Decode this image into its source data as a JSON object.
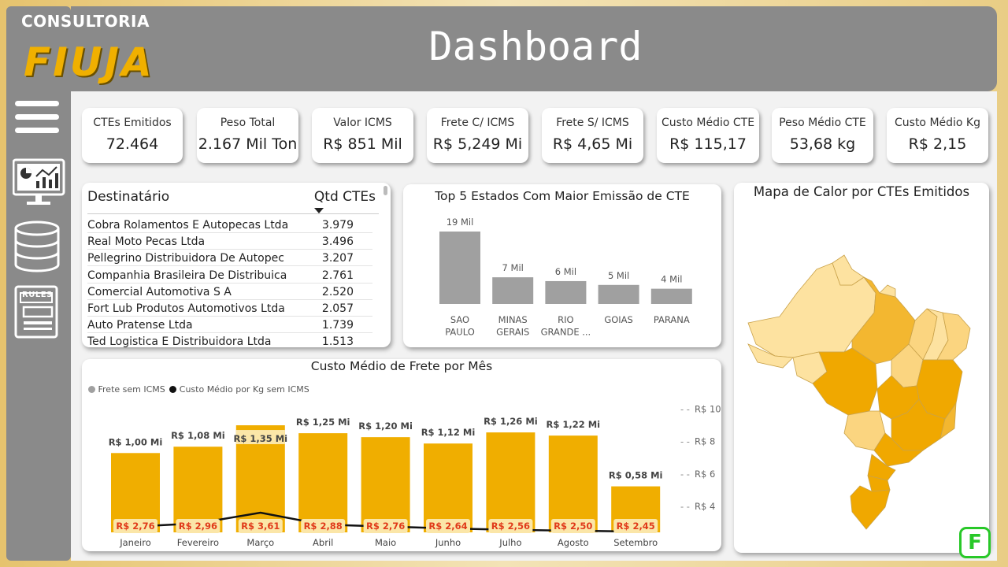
{
  "brand": {
    "line1": "CONSULTORIA",
    "line2": "FIUJA"
  },
  "header": {
    "title": "Dashboard"
  },
  "nav": [
    {
      "name": "menu",
      "icon": "hamburger-menu-icon"
    },
    {
      "name": "dashboard",
      "icon": "monitor-chart-icon"
    },
    {
      "name": "database",
      "icon": "database-icon"
    },
    {
      "name": "rules",
      "icon": "rules-book-icon",
      "label": "RULES"
    }
  ],
  "kpis": [
    {
      "label": "CTEs Emitidos",
      "value": "72.464"
    },
    {
      "label": "Peso Total",
      "value": "2.167 Mil Ton"
    },
    {
      "label": "Valor ICMS",
      "value": "R$ 851 Mil"
    },
    {
      "label": "Frete C/ ICMS",
      "value": "R$ 5,249 Mi"
    },
    {
      "label": "Frete S/ ICMS",
      "value": "R$ 4,65 Mi"
    },
    {
      "label": "Custo Médio CTE",
      "value": "R$ 115,17"
    },
    {
      "label": "Peso Médio CTE",
      "value": "53,68 kg"
    },
    {
      "label": "Custo Médio Kg",
      "value": "R$ 2,15"
    }
  ],
  "table": {
    "col1": "Destinatário",
    "col2": "Qtd CTEs",
    "rows": [
      {
        "name": "Cobra Rolamentos E Autopecas Ltda",
        "qty": "3.979"
      },
      {
        "name": "Real Moto Pecas Ltda",
        "qty": "3.496"
      },
      {
        "name": "Pellegrino Distribuidora De Autopec",
        "qty": "3.207"
      },
      {
        "name": "Companhia Brasileira De Distribuica",
        "qty": "2.761"
      },
      {
        "name": "Comercial Automotiva S A",
        "qty": "2.520"
      },
      {
        "name": "Fort Lub Produtos Automotivos Ltda",
        "qty": "2.057"
      },
      {
        "name": "Auto Pratense Ltda",
        "qty": "1.739"
      },
      {
        "name": "Ted Logistica E Distribuidora Ltda",
        "qty": "1.513"
      }
    ]
  },
  "map": {
    "title": "Mapa de Calor por CTEs Emitidos"
  },
  "badge": {
    "letter": "F"
  },
  "chart_data": [
    {
      "type": "bar",
      "title": "Top 5 Estados Com Maior Emissão de CTE",
      "categories": [
        [
          "SAO",
          "PAULO"
        ],
        [
          "MINAS",
          "GERAIS"
        ],
        [
          "RIO",
          "GRANDE ..."
        ],
        [
          "GOIAS"
        ],
        [
          "PARANA"
        ]
      ],
      "values": [
        19000,
        7000,
        6000,
        5000,
        4000
      ],
      "data_labels": [
        "19 Mil",
        "7 Mil",
        "6 Mil",
        "5 Mil",
        "4 Mil"
      ],
      "ylim": [
        0,
        19000
      ],
      "color": "#a0a0a0"
    },
    {
      "type": "bar",
      "title": "Custo Médio de Frete por Mês",
      "categories": [
        "Janeiro",
        "Fevereiro",
        "Março",
        "Abril",
        "Maio",
        "Junho",
        "Julho",
        "Agosto",
        "Setembro"
      ],
      "series": [
        {
          "name": "Frete sem ICMS",
          "type": "bar",
          "color": "#f0ae00",
          "values": [
            1.0,
            1.08,
            1.35,
            1.25,
            1.2,
            1.12,
            1.26,
            1.22,
            0.58
          ],
          "labels": [
            "R$ 1,00 Mi",
            "R$ 1,08 Mi",
            "R$ 1,35 Mi",
            "R$ 1,25 Mi",
            "R$ 1,20 Mi",
            "R$ 1,12 Mi",
            "R$ 1,26 Mi",
            "R$ 1,22 Mi",
            "R$ 0,58 Mi"
          ]
        },
        {
          "name": "Custo Médio por Kg sem ICMS",
          "type": "line",
          "color": "#111111",
          "values": [
            2.76,
            2.96,
            3.61,
            2.88,
            2.76,
            2.64,
            2.56,
            2.5,
            2.45
          ],
          "labels": [
            "R$ 2,76",
            "R$ 2,96",
            "R$ 3,61",
            "R$ 2,88",
            "R$ 2,76",
            "R$ 2,64",
            "R$ 2,56",
            "R$ 2,50",
            "R$ 2,45"
          ]
        }
      ],
      "ylim": [
        0,
        1.4
      ],
      "y2lim": [
        2.4,
        10.4
      ],
      "y2ticks": [
        4,
        6,
        8,
        10
      ],
      "y2tick_labels": [
        "R$ 4",
        "R$ 6",
        "R$ 8",
        "R$ 10"
      ],
      "legend": "top-left"
    }
  ]
}
